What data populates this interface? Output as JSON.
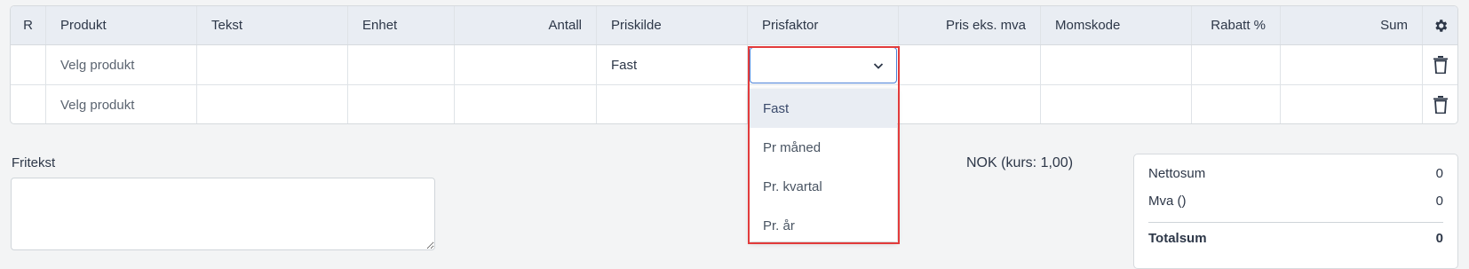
{
  "table": {
    "headers": {
      "r": "R",
      "produkt": "Produkt",
      "tekst": "Tekst",
      "enhet": "Enhet",
      "antall": "Antall",
      "priskilde": "Priskilde",
      "prisfaktor": "Prisfaktor",
      "pris": "Pris eks. mva",
      "momskode": "Momskode",
      "rabatt": "Rabatt %",
      "sum": "Sum"
    },
    "settings_icon": "gear-icon",
    "rows": [
      {
        "produkt": "Velg produkt",
        "priskilde": "Fast",
        "prisfaktor": "",
        "delete_icon": "trash-icon"
      },
      {
        "produkt": "Velg produkt",
        "priskilde": "",
        "prisfaktor": "",
        "delete_icon": "trash-icon"
      }
    ]
  },
  "prisfaktor_dropdown": {
    "selected": "Fast",
    "options": [
      "Fast",
      "Pr måned",
      "Pr. kvartal",
      "Pr. år"
    ]
  },
  "fritekst": {
    "label": "Fritekst",
    "value": ""
  },
  "currency": "NOK (kurs: 1,00)",
  "totals": {
    "nettosum_label": "Nettosum",
    "nettosum_value": "0",
    "mva_label": "Mva ()",
    "mva_value": "0",
    "totalsum_label": "Totalsum",
    "totalsum_value": "0"
  },
  "colors": {
    "highlight": "#e23b3b",
    "focus": "#4a7fd6",
    "header_bg": "#e9edf3"
  }
}
